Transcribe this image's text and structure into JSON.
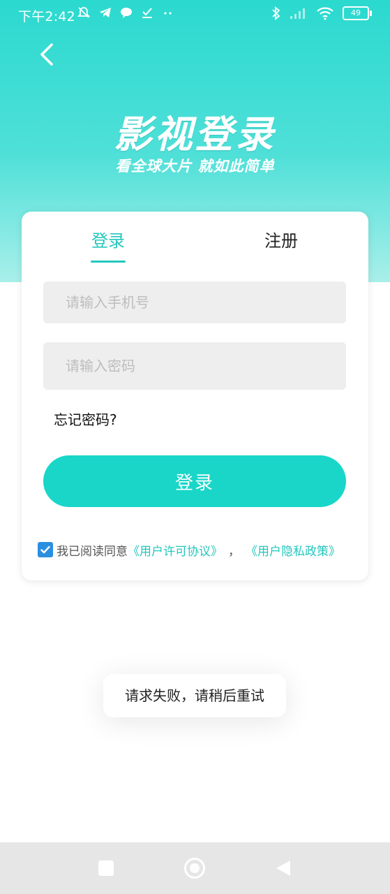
{
  "status_bar": {
    "time": "下午2:42",
    "battery": "49",
    "left_icons": [
      "mute-bell-icon",
      "telegram-icon",
      "chat-bubble-icon",
      "download-check-icon",
      "more-dots-icon"
    ],
    "right_icons": [
      "bluetooth-icon",
      "signal-icon",
      "wifi-icon",
      "battery-icon"
    ]
  },
  "hero": {
    "title": "影视登录",
    "subtitle": "看全球大片 就如此简单"
  },
  "tabs": {
    "login": "登录",
    "register": "注册",
    "active": "login"
  },
  "form": {
    "phone_placeholder": "请输入手机号",
    "phone_value": "",
    "password_placeholder": "请输入密码",
    "password_value": "",
    "forgot_label": "忘记密码?",
    "login_button": "登录"
  },
  "agreement": {
    "checked": true,
    "prefix": "我已阅读同意",
    "terms_link": "《用户许可协议》",
    "separator": "，",
    "privacy_link": "《用户隐私政策》"
  },
  "toast": {
    "message": "请求失败，请稍后重试"
  },
  "colors": {
    "accent": "#23c7bd",
    "button": "#19d6c8",
    "checkbox": "#2b8fe0",
    "hero_top": "#2bd9cf"
  }
}
